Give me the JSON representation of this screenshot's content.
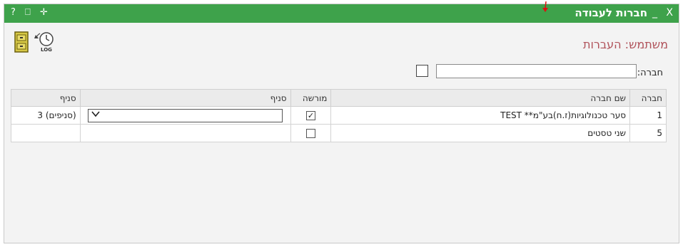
{
  "window": {
    "title": "חברות לעבודה",
    "close_glyph": "X",
    "minimize_glyph": "_",
    "help_glyph": "?",
    "print_glyph": "⎕",
    "move_glyph": "✛"
  },
  "toolbar": {
    "icons": [
      "file-cabinet-icon",
      "log-icon"
    ],
    "log_text": "LOG"
  },
  "user_line": "משתמש: העברות",
  "company_filter": {
    "label": "חברה:",
    "value": ""
  },
  "table": {
    "headers": {
      "company": "חברה",
      "company_name": "שם חברה",
      "authorized": "מורשה",
      "branch": "סניף",
      "branch2": "סניף"
    },
    "rows": [
      {
        "company": "1",
        "company_name": "סער טכנולוגיות(ז.ח)בע\"מ** TEST",
        "authorized": true,
        "branch_select": "",
        "branch_text": "(סניפים) 3"
      },
      {
        "company": "5",
        "company_name": "שני טסטים",
        "authorized": false,
        "branch_select": null,
        "branch_text": ""
      }
    ]
  },
  "colors": {
    "titlebar": "#3ea24b",
    "user_line": "#b0525a"
  }
}
